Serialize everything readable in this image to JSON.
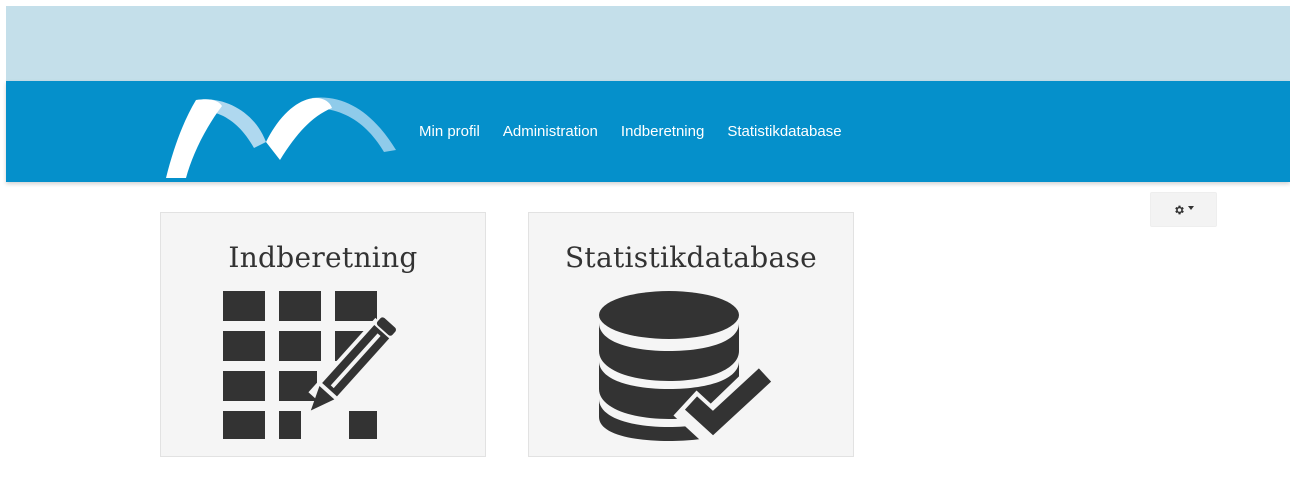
{
  "nav": {
    "logo": "logo-icon",
    "links": [
      {
        "label": "Min profil"
      },
      {
        "label": "Administration"
      },
      {
        "label": "Indberetning"
      },
      {
        "label": "Statistikdatabase"
      }
    ]
  },
  "toolbar": {
    "settings_icon": "gear-icon"
  },
  "cards": [
    {
      "title": "Indberetning",
      "icon": "grid-pencil-icon"
    },
    {
      "title": "Statistikdatabase",
      "icon": "database-check-icon"
    }
  ],
  "colors": {
    "top_strip": "#c4dfea",
    "navbar": "#0590cb",
    "card_background": "#f5f5f5",
    "icon": "#333333"
  }
}
